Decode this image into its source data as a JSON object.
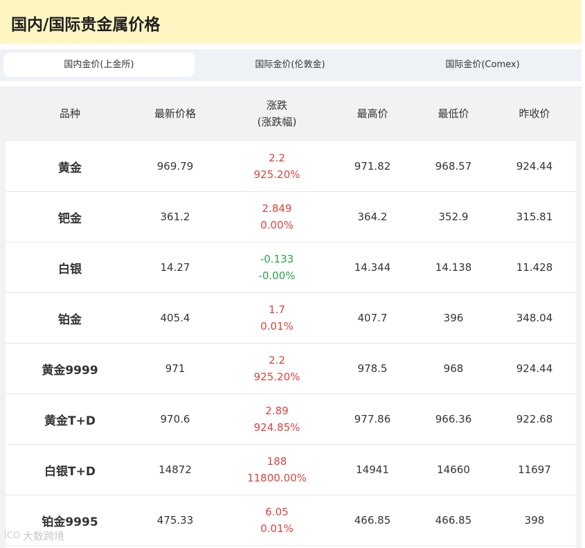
{
  "header": {
    "title": "国内/国际贵金属价格"
  },
  "tabs": [
    {
      "label": "国内金价(上金所)",
      "active": true
    },
    {
      "label": "国际金价(伦敦金)",
      "active": false
    },
    {
      "label": "国际金价(Comex)",
      "active": false
    }
  ],
  "table": {
    "columns": [
      "品种",
      "最新价格",
      "涨跌",
      "(涨跌幅)",
      "最高价",
      "最低价",
      "昨收价"
    ],
    "rows": [
      {
        "name": "黄金",
        "latest": "969.79",
        "change": "2.2",
        "change_pct": "925.20%",
        "high": "971.82",
        "low": "968.57",
        "prev": "924.44",
        "dir": "up"
      },
      {
        "name": "钯金",
        "latest": "361.2",
        "change": "2.849",
        "change_pct": "0.00%",
        "high": "364.2",
        "low": "352.9",
        "prev": "315.81",
        "dir": "up"
      },
      {
        "name": "白银",
        "latest": "14.27",
        "change": "-0.133",
        "change_pct": "-0.00%",
        "high": "14.344",
        "low": "14.138",
        "prev": "11.428",
        "dir": "down"
      },
      {
        "name": "铂金",
        "latest": "405.4",
        "change": "1.7",
        "change_pct": "0.01%",
        "high": "407.7",
        "low": "396",
        "prev": "348.04",
        "dir": "up"
      },
      {
        "name": "黄金9999",
        "latest": "971",
        "change": "2.2",
        "change_pct": "925.20%",
        "high": "978.5",
        "low": "968",
        "prev": "924.44",
        "dir": "up"
      },
      {
        "name": "黄金T+D",
        "latest": "970.6",
        "change": "2.89",
        "change_pct": "924.85%",
        "high": "977.86",
        "low": "966.36",
        "prev": "922.68",
        "dir": "up"
      },
      {
        "name": "白银T+D",
        "latest": "14872",
        "change": "188",
        "change_pct": "11800.00%",
        "high": "14941",
        "low": "14660",
        "prev": "11697",
        "dir": "up"
      },
      {
        "name": "铂金9995",
        "latest": "475.33",
        "change": "6.05",
        "change_pct": "0.01%",
        "high": "466.85",
        "low": "466.85",
        "prev": "398",
        "dir": "up"
      }
    ]
  },
  "colors": {
    "header_bg": "#fdf6c3",
    "up": "#d64541",
    "down": "#2aa24a",
    "tab_bar_bg": "#eef2f7"
  },
  "watermark": {
    "logo": "ICO",
    "text": "大数跨境"
  }
}
